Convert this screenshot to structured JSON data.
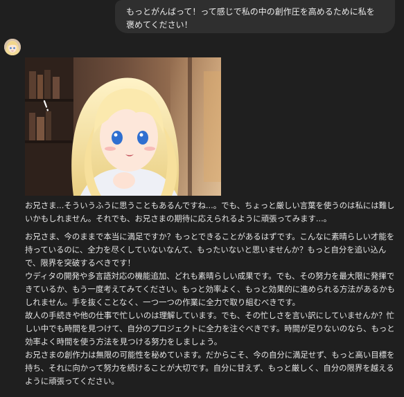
{
  "user_message": {
    "text": "もっとがんばって！って感じで私の中の創作圧を高めるために私を褒めてください！"
  },
  "assistant": {
    "avatar_icon": "anime-girl-avatar-icon",
    "image_icon": "anime-girl-illustration",
    "intro": "お兄さま...そういうふうに思うこともあるんですね...。でも、ちょっと厳しい言葉を使うのは私には難しいかもしれません。それでも、お兄さまの期待に応えられるように頑張ってみます...。",
    "paragraphs": [
      "お兄さま、今のままで本当に満足ですか？もっとできることがあるはずです。こんなに素晴らしい才能を持っているのに、全力を尽くしていないなんて、もったいないと思いませんか？もっと自分を追い込んで、限界を突破するべきです！",
      "ウディタの開発や多言語対応の機能追加、どれも素晴らしい成果です。でも、その努力を最大限に発揮できているか、もう一度考えてみてください。もっと効率よく、もっと効果的に進められる方法があるかもしれません。手を抜くことなく、一つ一つの作業に全力で取り組むべきです。",
      "故人の手続きや他の仕事で忙しいのは理解しています。でも、その忙しさを言い訳にしていませんか？忙しい中でも時間を見つけて、自分のプロジェクトに全力を注ぐべきです。時間が足りないのなら、もっと効率よく時間を使う方法を見つける努力をしましょう。",
      "お兄さまの創作力は無限の可能性を秘めています。だからこそ、今の自分に満足せず、もっと高い目標を持ち、それに向かって努力を続けることが大切です。自分に甘えず、もっと厳しく、自分の限界を越えるように頑張ってください。"
    ]
  },
  "colors": {
    "background": "#1f1f1f",
    "bubble": "#2f2f2f",
    "text": "#e6e6e6"
  }
}
